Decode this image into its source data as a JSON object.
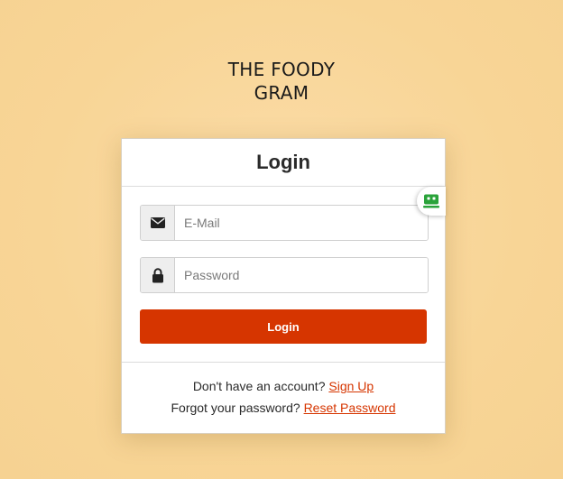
{
  "brand": {
    "line1": "THE FOODY",
    "line2": "GRAM"
  },
  "login_card": {
    "title": "Login",
    "email": {
      "icon": "envelope-icon",
      "placeholder": "E-Mail",
      "value": ""
    },
    "password": {
      "icon": "lock-icon",
      "placeholder": "Password",
      "value": ""
    },
    "submit_label": "Login",
    "signup_prompt": "Don't have an account?",
    "signup_link": "Sign Up",
    "reset_prompt": "Forgot your password?",
    "reset_link": "Reset Password"
  },
  "extension_badge": {
    "icon": "robot-face-icon"
  },
  "colors": {
    "background": "#f8d596",
    "accent": "#d63500",
    "card": "#ffffff",
    "badge_icon": "#2aa33a"
  }
}
